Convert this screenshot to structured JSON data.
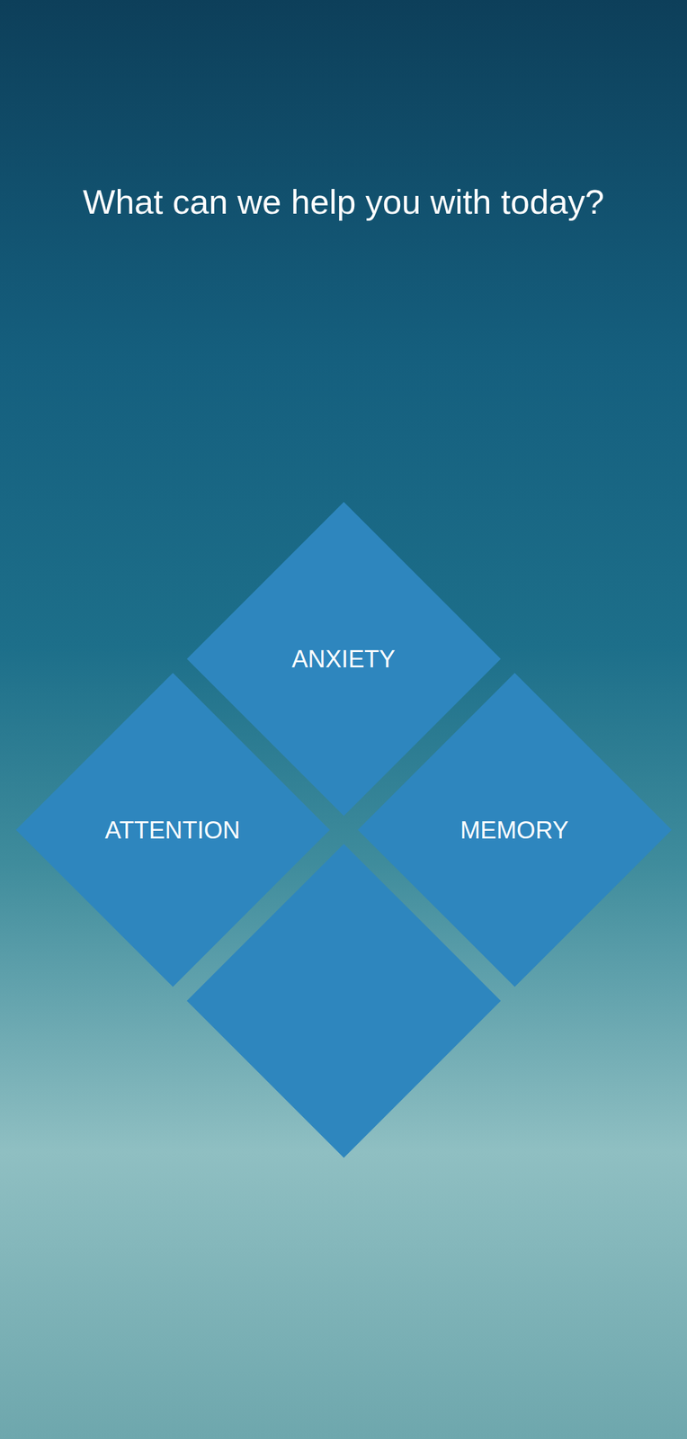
{
  "screen": {
    "title": "What can we help you with today?"
  },
  "tiles": [
    {
      "label": "ANXIETY"
    },
    {
      "label": "MEMORY"
    },
    {
      "label": "ATTENTION"
    },
    {
      "label": null
    }
  ]
}
